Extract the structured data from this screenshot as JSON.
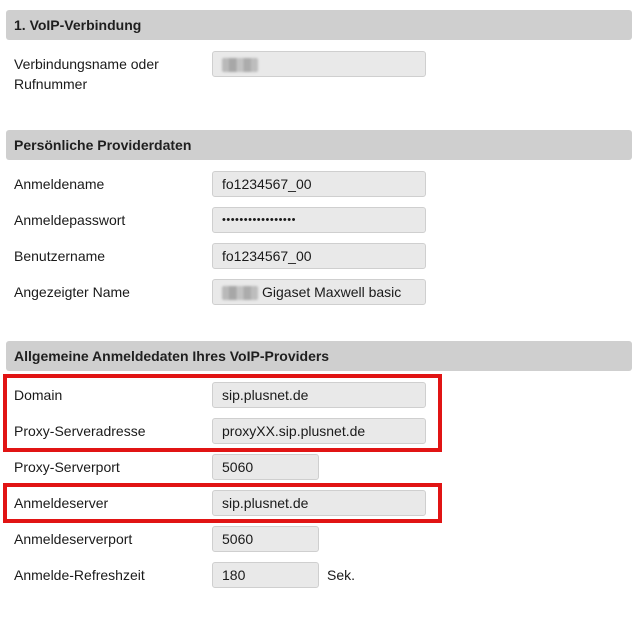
{
  "section1": {
    "header": "1. VoIP-Verbindung",
    "connection_name_label_line1": "Verbindungsname oder",
    "connection_name_label_line2": "Rufnummer",
    "connection_name_value": ""
  },
  "section2": {
    "header": "Persönliche Providerdaten",
    "login_name_label": "Anmeldename",
    "login_name_value": "fo1234567_00",
    "login_password_label": "Anmeldepasswort",
    "login_password_value": "•••••••••••••••••",
    "username_label": "Benutzername",
    "username_value": "fo1234567_00",
    "display_name_label": "Angezeigter Name",
    "display_name_value": "Gigaset Maxwell basic"
  },
  "section3": {
    "header": "Allgemeine Anmeldedaten Ihres VoIP-Providers",
    "domain_label": "Domain",
    "domain_value": "sip.plusnet.de",
    "proxy_address_label": "Proxy-Serveradresse",
    "proxy_address_value": "proxyXX.sip.plusnet.de",
    "proxy_port_label": "Proxy-Serverport",
    "proxy_port_value": "5060",
    "registrar_label": "Anmeldeserver",
    "registrar_value": "sip.plusnet.de",
    "registrar_port_label": "Anmeldeserverport",
    "registrar_port_value": "5060",
    "refresh_label": "Anmelde-Refreshzeit",
    "refresh_value": "180",
    "refresh_unit": "Sek."
  },
  "colors": {
    "header_bg": "#cfcfcf",
    "field_bg": "#e9e9e9",
    "highlight": "#e11414"
  }
}
